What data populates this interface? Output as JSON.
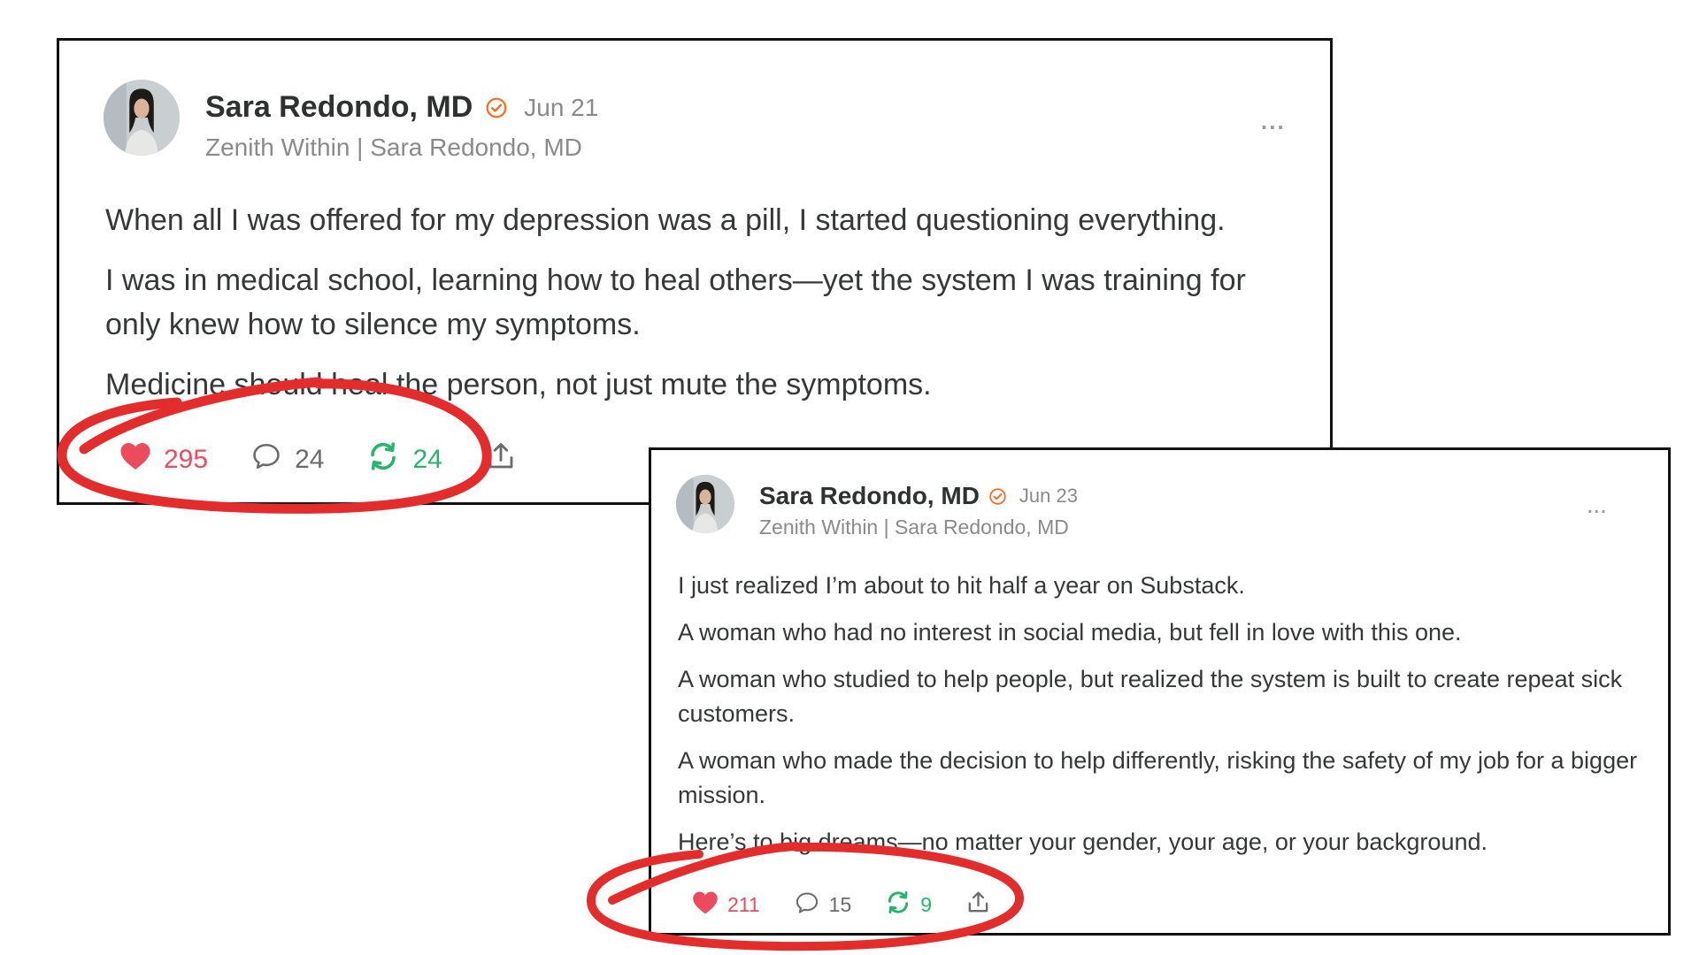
{
  "colors": {
    "like": "#ec4b5e",
    "restack": "#26b56a",
    "verified": "#ff6719",
    "annotation": "#e32d2d",
    "border": "#111111"
  },
  "posts": [
    {
      "author": "Sara Redondo, MD",
      "date": "Jun 21",
      "publication": "Zenith Within | Sara Redondo, MD",
      "more": "...",
      "paragraphs": [
        "When all I was offered for my depression was a pill, I started questioning everything.",
        "I was in medical school, learning how to heal others—yet the system I was training for only knew how to silence my symptoms.",
        "Medicine should heal the person, not just mute the symptoms."
      ],
      "likes": "295",
      "comments": "24",
      "restacks": "24",
      "icons": [
        "heart-icon",
        "comment-icon",
        "restack-icon",
        "share-icon",
        "verified-check-icon",
        "more-icon"
      ]
    },
    {
      "author": "Sara Redondo, MD",
      "date": "Jun 23",
      "publication": "Zenith Within | Sara Redondo, MD",
      "more": "...",
      "paragraphs": [
        "I just realized I’m about to hit half a year on Substack.",
        "A woman who had no interest in social media, but fell in love with this one.",
        "A woman who studied to help people, but realized the system is built to create repeat sick customers.",
        "A woman who made the decision to help differently, risking the safety of my job for a bigger mission.",
        "Here’s to big dreams—no matter your gender, your age, or your background."
      ],
      "likes": "211",
      "comments": "15",
      "restacks": "9",
      "icons": [
        "heart-icon",
        "comment-icon",
        "restack-icon",
        "share-icon",
        "verified-check-icon",
        "more-icon"
      ]
    }
  ]
}
